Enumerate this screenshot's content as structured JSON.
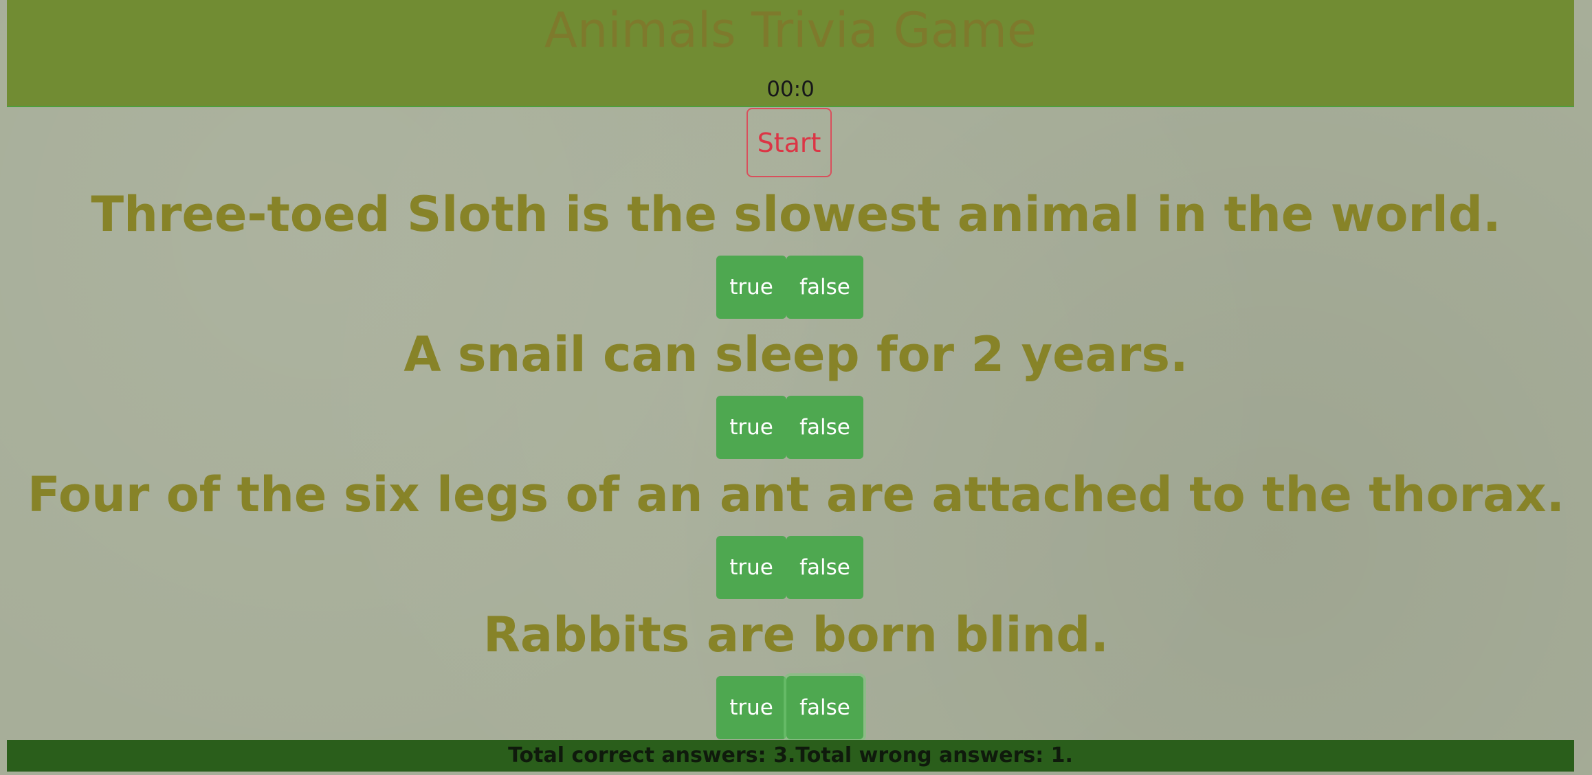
{
  "header": {
    "title": "Animals Trivia Game",
    "timer": "00:0"
  },
  "controls": {
    "start_label": "Start"
  },
  "questions": [
    {
      "text": "Three-toed Sloth is the slowest animal in the world.",
      "true_label": "true",
      "false_label": "false"
    },
    {
      "text": "A snail can sleep for 2 years.",
      "true_label": "true",
      "false_label": "false"
    },
    {
      "text": "Four of the six legs of an ant are attached to the thorax.",
      "true_label": "true",
      "false_label": "false"
    },
    {
      "text": "Rabbits are born blind.",
      "true_label": "true",
      "false_label": "false"
    }
  ],
  "footer": {
    "summary": "Total correct answers: 3.Total wrong answers: 1."
  },
  "colors": {
    "header_bg": "#718c33",
    "title_text": "#7e7a2c",
    "question_text": "#878328",
    "answer_button": "#4ea850",
    "start_button": "#dc3545",
    "footer_bg": "#2a5e1b"
  }
}
